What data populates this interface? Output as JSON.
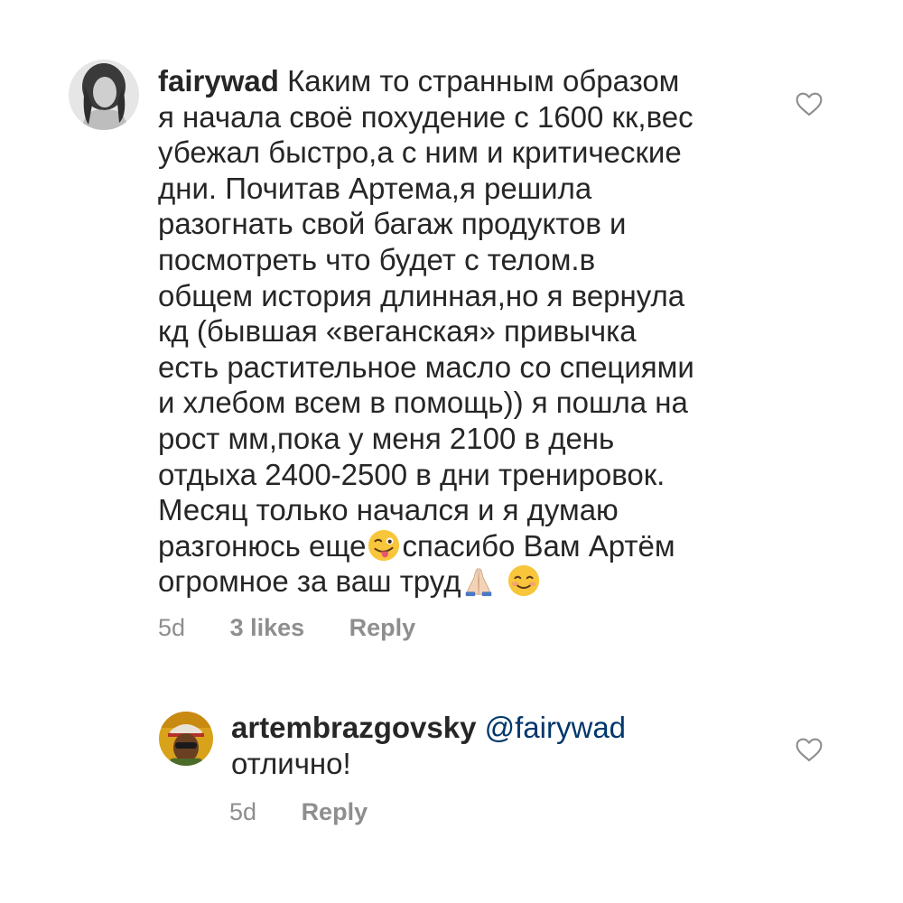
{
  "comments": [
    {
      "username": "fairywad",
      "lines": [
        "Каким то странным образом",
        "я начала своё похудение с 1600 кк,вес",
        "убежал быстро,а с ним и критические",
        "дни. Почитав Артема,я решила",
        "разогнать свой багаж продуктов и",
        "посмотреть что будет с телом.в",
        "общем история длинная,но я вернула",
        "кд (бывшая «веганская» привычка",
        "есть растительное масло со специями",
        "и хлебом всем в помощь)) я пошла на",
        "рост мм,пока у меня 2100 в день",
        "отдыха 2400-2500 в дни тренировок.",
        "Месяц только начался и я думаю"
      ],
      "line14_part1": "разгонюсь еще",
      "line14_part2": "спасибо Вам Артём",
      "line15": "огромное за ваш труд",
      "time": "5d",
      "likes": "3 likes",
      "reply": "Reply",
      "emojis": [
        "winking-face-with-tongue",
        "folded-hands",
        "smiling-face"
      ]
    },
    {
      "username": "artembrazgovsky",
      "mention": "@fairywad",
      "text": "отлично!",
      "time": "5d",
      "reply": "Reply"
    }
  ],
  "colors": {
    "text": "#262626",
    "meta": "#8e8e8e",
    "mention": "#00376b"
  }
}
